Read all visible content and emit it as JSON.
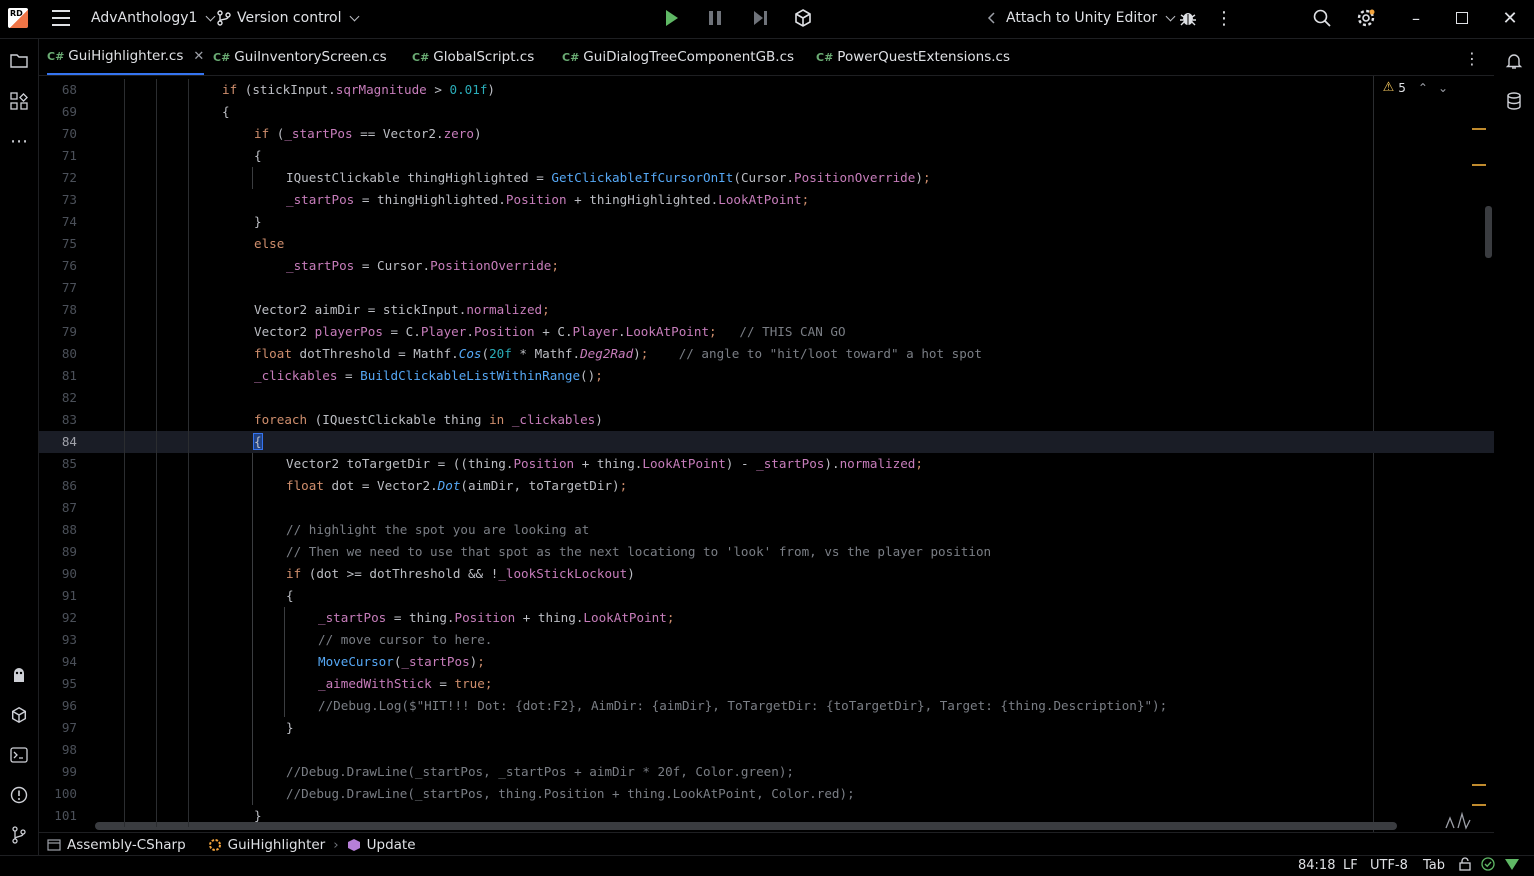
{
  "titlebar": {
    "logo_text": "RD",
    "project": "AdvAnthology1",
    "vcs": "Version control",
    "attach": "Attach to Unity Editor"
  },
  "tabs": [
    {
      "prefix": "C#",
      "label": "GuiHighlighter.cs",
      "active": true
    },
    {
      "prefix": "C#",
      "label": "GuiInventoryScreen.cs"
    },
    {
      "prefix": "C#",
      "label": "GlobalScript.cs"
    },
    {
      "prefix": "C#",
      "label": "GuiDialogTreeComponentGB.cs"
    },
    {
      "prefix": "C#",
      "label": "PowerQuestExtensions.cs"
    }
  ],
  "inspections": {
    "warnings": "5"
  },
  "lines": [
    {
      "n": "68",
      "t": "if (stickInput.sqrMagnitude > 0.01f)"
    },
    {
      "n": "69",
      "t": "{"
    },
    {
      "n": "70",
      "t": "if (_startPos == Vector2.zero)"
    },
    {
      "n": "71",
      "t": "{"
    },
    {
      "n": "72",
      "t": "IQuestClickable thingHighlighted = GetClickableIfCursorOnIt(Cursor.PositionOverride);"
    },
    {
      "n": "73",
      "t": "_startPos = thingHighlighted.Position + thingHighlighted.LookAtPoint;"
    },
    {
      "n": "74",
      "t": "}"
    },
    {
      "n": "75",
      "t": "else"
    },
    {
      "n": "76",
      "t": "_startPos = Cursor.PositionOverride;"
    },
    {
      "n": "77",
      "t": ""
    },
    {
      "n": "78",
      "t": "Vector2 aimDir = stickInput.normalized;"
    },
    {
      "n": "79",
      "t": "Vector2 playerPos = C.Player.Position + C.Player.LookAtPoint;   // THIS CAN GO"
    },
    {
      "n": "80",
      "t": "float dotThreshold = Mathf.Cos(20f * Mathf.Deg2Rad);    // angle to \"hit/loot toward\" a hot spot"
    },
    {
      "n": "81",
      "t": "_clickables = BuildClickableListWithinRange();"
    },
    {
      "n": "82",
      "t": ""
    },
    {
      "n": "83",
      "t": "foreach (IQuestClickable thing in _clickables)"
    },
    {
      "n": "84",
      "t": "{"
    },
    {
      "n": "85",
      "t": "Vector2 toTargetDir = ((thing.Position + thing.LookAtPoint) - _startPos).normalized;"
    },
    {
      "n": "86",
      "t": "float dot = Vector2.Dot(aimDir, toTargetDir);"
    },
    {
      "n": "87",
      "t": ""
    },
    {
      "n": "88",
      "t": "// highlight the spot you are looking at"
    },
    {
      "n": "89",
      "t": "// Then we need to use that spot as the next locationg to 'look' from, vs the player position"
    },
    {
      "n": "90",
      "t": "if (dot >= dotThreshold && !_lookStickLockout)"
    },
    {
      "n": "91",
      "t": "{"
    },
    {
      "n": "92",
      "t": "_startPos = thing.Position + thing.LookAtPoint;"
    },
    {
      "n": "93",
      "t": "// move cursor to here."
    },
    {
      "n": "94",
      "t": "MoveCursor(_startPos);"
    },
    {
      "n": "95",
      "t": "_aimedWithStick = true;"
    },
    {
      "n": "96",
      "t": "//Debug.Log($\"HIT!!! Dot: {dot:F2}, AimDir: {aimDir}, ToTargetDir: {toTargetDir}, Target: {thing.Description}\");"
    },
    {
      "n": "97",
      "t": "}"
    },
    {
      "n": "98",
      "t": ""
    },
    {
      "n": "99",
      "t": "//Debug.DrawLine(_startPos, _startPos + aimDir * 20f, Color.green);"
    },
    {
      "n": "100",
      "t": "//Debug.DrawLine(_startPos, thing.Position + thing.LookAtPoint, Color.red);"
    },
    {
      "n": "101",
      "t": "}"
    }
  ],
  "breadcrumbs": [
    "Assembly-CSharp",
    "GuiHighlighter",
    "Update"
  ],
  "status": {
    "position": "84:18",
    "line_ending": "LF",
    "encoding": "UTF-8",
    "indent": "Tab"
  },
  "colors": {
    "keyword": "#cf8e6d",
    "method": "#56a8f5",
    "member": "#c77dbb",
    "number": "#2aacb8",
    "comment": "#7a7e85",
    "accent": "#3574f0"
  }
}
